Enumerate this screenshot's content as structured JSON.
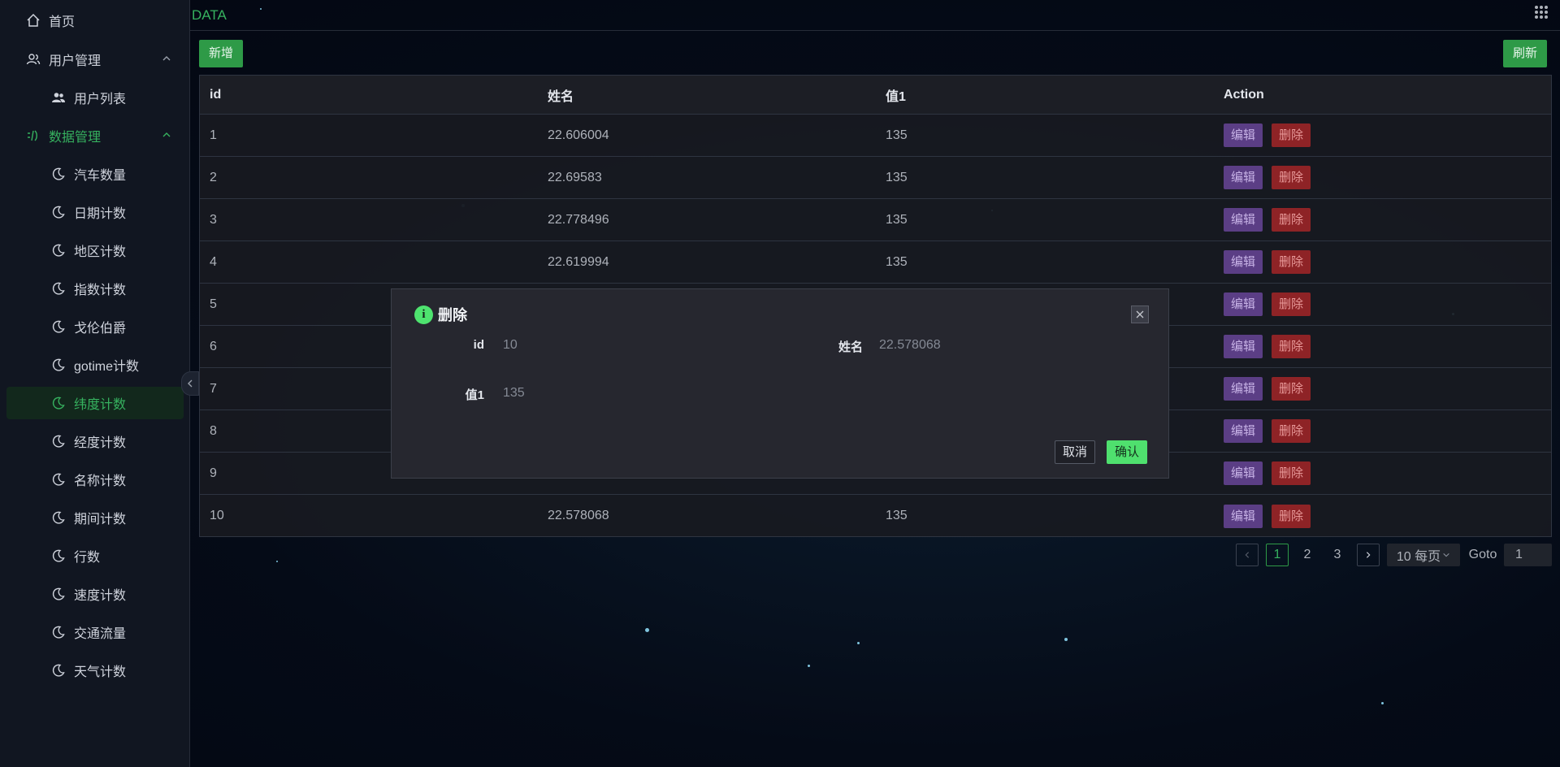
{
  "sidebar": {
    "home_label": "首页",
    "user_group": {
      "label": "用户管理",
      "items": [
        {
          "label": "用户列表"
        }
      ]
    },
    "data_group": {
      "label": "数据管理",
      "items": [
        {
          "label": "汽车数量"
        },
        {
          "label": "日期计数"
        },
        {
          "label": "地区计数"
        },
        {
          "label": "指数计数"
        },
        {
          "label": "戈伦伯爵"
        },
        {
          "label": "gotime计数"
        },
        {
          "label": "纬度计数"
        },
        {
          "label": "经度计数"
        },
        {
          "label": "名称计数"
        },
        {
          "label": "期间计数"
        },
        {
          "label": "行数"
        },
        {
          "label": "速度计数"
        },
        {
          "label": "交通流量"
        },
        {
          "label": "天气计数"
        }
      ],
      "active_item": "纬度计数"
    }
  },
  "header": {
    "title": "DATA"
  },
  "toolbar": {
    "add_label": "新增",
    "refresh_label": "刷新"
  },
  "table": {
    "columns": [
      "id",
      "姓名",
      "值1",
      "Action"
    ],
    "edit_label": "编辑",
    "delete_label": "删除",
    "rows": [
      {
        "id": "1",
        "name": "22.606004",
        "value1": "135"
      },
      {
        "id": "2",
        "name": "22.69583",
        "value1": "135"
      },
      {
        "id": "3",
        "name": "22.778496",
        "value1": "135"
      },
      {
        "id": "4",
        "name": "22.619994",
        "value1": "135"
      },
      {
        "id": "5",
        "name": "",
        "value1": ""
      },
      {
        "id": "6",
        "name": "",
        "value1": ""
      },
      {
        "id": "7",
        "name": "",
        "value1": ""
      },
      {
        "id": "8",
        "name": "",
        "value1": ""
      },
      {
        "id": "9",
        "name": "",
        "value1": ""
      },
      {
        "id": "10",
        "name": "22.578068",
        "value1": "135"
      }
    ]
  },
  "pagination": {
    "pages": [
      "1",
      "2",
      "3"
    ],
    "current_page": "1",
    "page_size_label": "10 每页",
    "goto_label": "Goto",
    "goto_value": "1"
  },
  "modal": {
    "title": "删除",
    "fields": {
      "id_label": "id",
      "id_value": "10",
      "name_label": "姓名",
      "name_value": "22.578068",
      "value1_label": "值1",
      "value1_value": "135"
    },
    "cancel_label": "取消",
    "confirm_label": "确认"
  },
  "colors": {
    "accent": "#2e9a47",
    "edit": "#5b3e85",
    "delete": "#8e2326",
    "confirm": "#4fe06e"
  }
}
